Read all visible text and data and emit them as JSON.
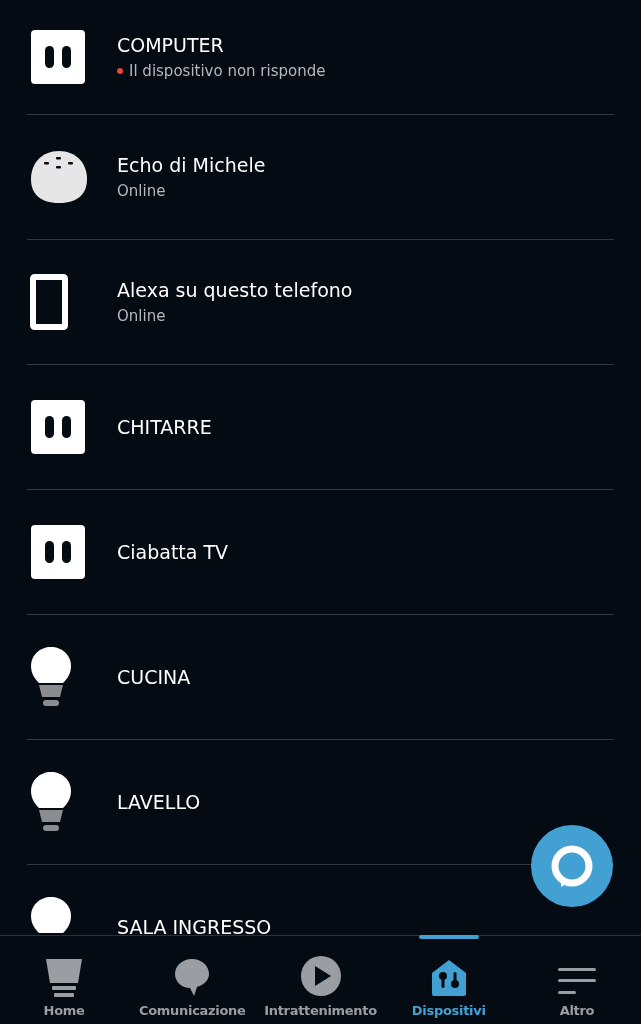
{
  "devices": [
    {
      "kind": "plug",
      "name": "COMPUTER",
      "status": {
        "text": "Il dispositivo non risponde",
        "kind": "error"
      }
    },
    {
      "kind": "echo",
      "name": "Echo di Michele",
      "status": {
        "text": "Online",
        "kind": "ok"
      }
    },
    {
      "kind": "phone",
      "name": "Alexa su questo telefono",
      "status": {
        "text": "Online",
        "kind": "ok"
      }
    },
    {
      "kind": "plug",
      "name": "CHITARRE"
    },
    {
      "kind": "plug",
      "name": "Ciabatta TV"
    },
    {
      "kind": "bulb",
      "name": "CUCINA"
    },
    {
      "kind": "bulb",
      "name": "LAVELLO"
    },
    {
      "kind": "bulb",
      "name": "SALA INGRESSO"
    }
  ],
  "nav": [
    {
      "kind": "home",
      "label": "Home",
      "selected": false
    },
    {
      "kind": "chat",
      "label": "Comunicazione",
      "selected": false
    },
    {
      "kind": "play",
      "label": "Intrattenimento",
      "selected": false
    },
    {
      "kind": "devices",
      "label": "Dispositivi",
      "selected": true
    },
    {
      "kind": "menu",
      "label": "Altro",
      "selected": false
    }
  ]
}
